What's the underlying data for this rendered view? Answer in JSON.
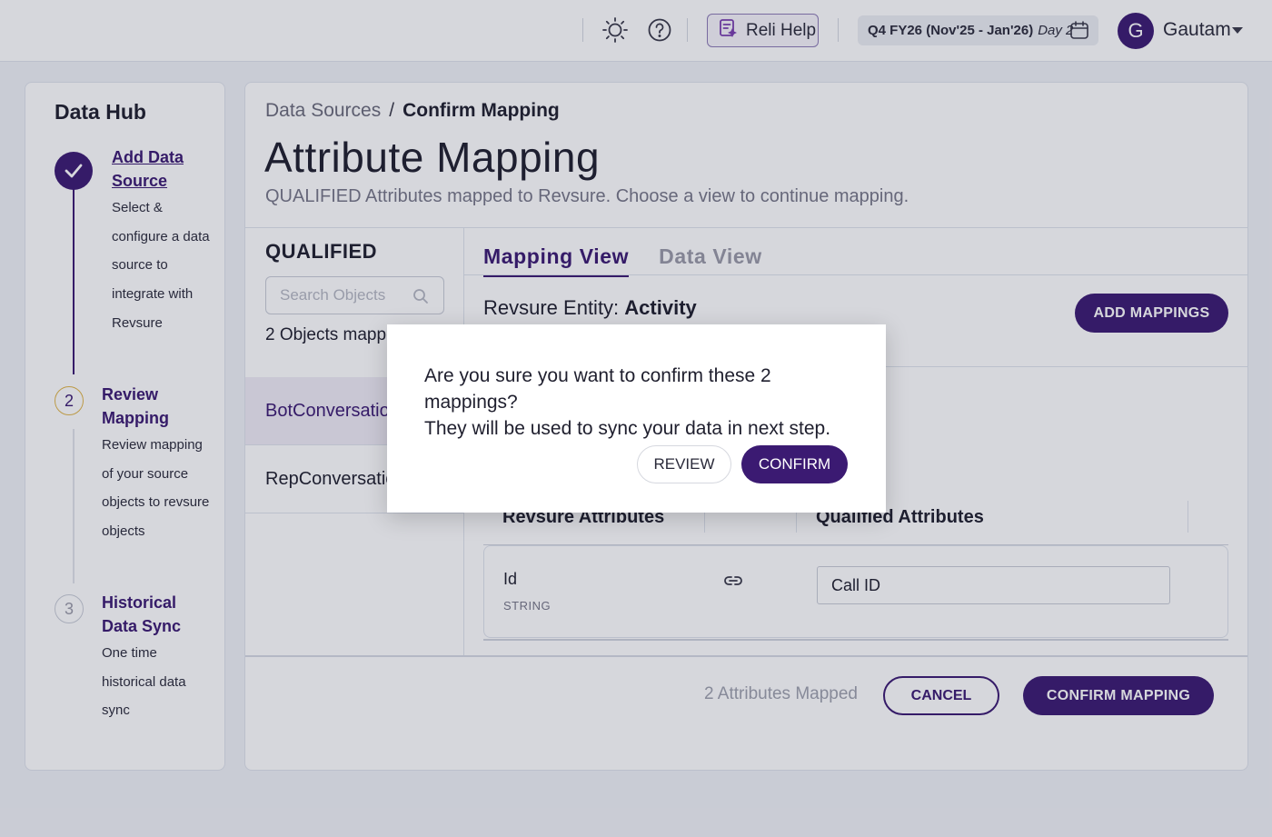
{
  "colors": {
    "accent": "#3b1a72",
    "muted_text": "#777788",
    "step_pending_border": "#e0b54a"
  },
  "header": {
    "reli_help_label": "Reli Help",
    "quarter_label": "Q4 FY26 (Nov'25 - Jan'26)",
    "day_label": "Day 2",
    "avatar_initial": "G",
    "user_name": "Gautam",
    "icons": [
      "sun-icon",
      "help-circle-icon",
      "reli-help-icon",
      "calendar-icon",
      "caret-down-icon"
    ]
  },
  "sidebar": {
    "title": "Data Hub",
    "steps": [
      {
        "number": "",
        "status": "done",
        "title": "Add Data Source",
        "description": [
          "Select &",
          "configure a data",
          "source to",
          "integrate with",
          "Revsure"
        ]
      },
      {
        "number": "2",
        "status": "current",
        "title": "Review Mapping",
        "description": [
          "Review mapping",
          "of your source",
          "objects to revsure",
          "objects"
        ]
      },
      {
        "number": "3",
        "status": "pending",
        "title": "Historical Data Sync",
        "description": [
          "One time",
          "historical data",
          "sync"
        ]
      }
    ]
  },
  "main": {
    "breadcrumb": {
      "parent": "Data Sources",
      "separator": "/",
      "current": "Confirm Mapping"
    },
    "title": "Attribute Mapping",
    "subtitle": "QUALIFIED Attributes mapped to Revsure. Choose a view to continue mapping.",
    "objects_panel": {
      "title": "QUALIFIED",
      "search_placeholder": "Search Objects",
      "count_label": "2 Objects mapped",
      "items": [
        "BotConversation",
        "RepConversation"
      ]
    },
    "tabs": [
      {
        "label": "Mapping View",
        "active": true
      },
      {
        "label": "Data View",
        "active": false
      }
    ],
    "entity_prefix": "Revsure Entity:",
    "entity_name": "Activity",
    "add_mappings_label": "ADD MAPPINGS",
    "table": {
      "headers": [
        "Revsure Attributes",
        "Qualified Attributes"
      ],
      "rows": [
        {
          "name": "Id",
          "type": "STRING",
          "qualified": "Call ID"
        }
      ]
    },
    "footer": {
      "note": "2 Attributes Mapped",
      "cancel_label": "CANCEL",
      "confirm_label": "CONFIRM MAPPING"
    }
  },
  "modal": {
    "message_line1": "Are you sure you want to confirm these 2 mappings?",
    "message_line2": "They will be used to sync your data in next step.",
    "review_label": "REVIEW",
    "confirm_label": "CONFIRM"
  }
}
